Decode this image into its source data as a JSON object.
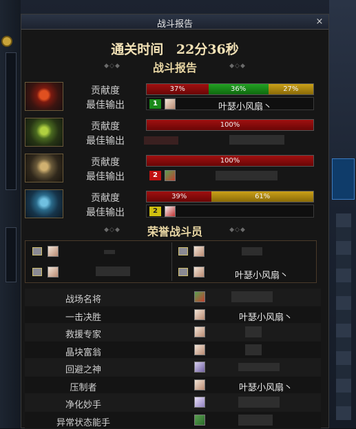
{
  "window": {
    "title": "战斗报告",
    "close": "×"
  },
  "clear_time": {
    "label": "通关时间",
    "value": "22分36秒"
  },
  "report_header": {
    "title": "战斗报告",
    "ornament_left": "◆◇◆",
    "ornament_right": "◆◇◆"
  },
  "bosses": [
    {
      "contrib_label": "贡献度",
      "best_label": "最佳输出",
      "segments": [
        {
          "text": "37%",
          "value": 37,
          "color": "red"
        },
        {
          "text": "36%",
          "value": 36,
          "color": "green"
        },
        {
          "text": "27%",
          "value": 27,
          "color": "gold"
        }
      ],
      "rank": "1",
      "rank_color": "#1a8a1a",
      "player": "叶瑟小风扇丶"
    },
    {
      "contrib_label": "贡献度",
      "best_label": "最佳输出",
      "segments": [
        {
          "text": "100%",
          "value": 100,
          "color": "red"
        }
      ],
      "rank": "",
      "rank_color": "",
      "player": ""
    },
    {
      "contrib_label": "贡献度",
      "best_label": "最佳输出",
      "segments": [
        {
          "text": "100%",
          "value": 100,
          "color": "red"
        }
      ],
      "rank": "2",
      "rank_color": "#c01010",
      "player": ""
    },
    {
      "contrib_label": "贡献度",
      "best_label": "最佳输出",
      "segments": [
        {
          "text": "39%",
          "value": 39,
          "color": "red"
        },
        {
          "text": "61%",
          "value": 61,
          "color": "gold"
        }
      ],
      "rank": "2",
      "rank_color": "#d0c010",
      "player": ""
    }
  ],
  "honor_header": {
    "title": "荣誉战斗员",
    "ornament_left": "◆◇◆",
    "ornament_right": "◆◇◆"
  },
  "honor": [
    {
      "player": ""
    },
    {
      "player": ""
    },
    {
      "player": ""
    },
    {
      "player": "叶瑟小风扇丶"
    }
  ],
  "titles": [
    {
      "name": "战场名将",
      "player": ""
    },
    {
      "name": "一击决胜",
      "player": "叶瑟小风扇丶"
    },
    {
      "name": "救援专家",
      "player": ""
    },
    {
      "name": "晶块富翁",
      "player": ""
    },
    {
      "name": "回避之神",
      "player": ""
    },
    {
      "name": "压制者",
      "player": "叶瑟小风扇丶"
    },
    {
      "name": "净化妙手",
      "player": ""
    },
    {
      "name": "异常状态能手",
      "player": ""
    }
  ],
  "colors": {
    "red": "#a01010",
    "green": "#22a022",
    "gold": "#caa018",
    "title_gold": "#e9d7a4"
  },
  "icons": {
    "close": "close-icon",
    "medal": "medal-icon",
    "avatar": "avatar"
  }
}
